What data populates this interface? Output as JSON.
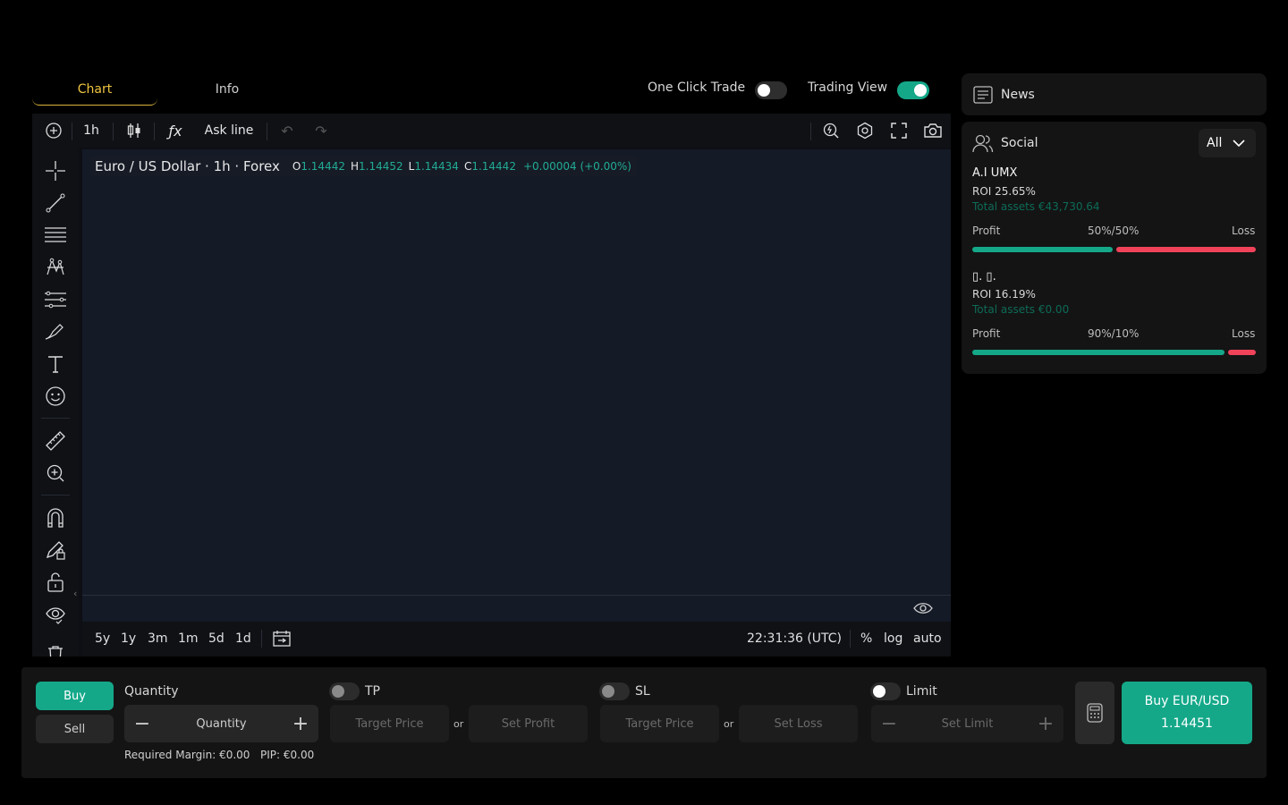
{
  "tabs": [
    {
      "label": "Chart",
      "active": true
    },
    {
      "label": "Info",
      "active": false
    }
  ],
  "toggles": {
    "one_click_trade": {
      "label": "One Click Trade",
      "on": false
    },
    "trading_view": {
      "label": "Trading View",
      "on": true
    }
  },
  "chart_toolbar": {
    "interval": "1h",
    "price_line": "Ask line"
  },
  "chart_legend": {
    "title": "Euro / US Dollar · 1h · Forex",
    "open_label": "O",
    "open": "1.14442",
    "high_label": "H",
    "high": "1.14452",
    "low_label": "L",
    "low": "1.14434",
    "close_label": "C",
    "close": "1.14442",
    "change": "+0.00004 (+0.00%)"
  },
  "chart_bottom": {
    "ranges": [
      "5y",
      "1y",
      "3m",
      "1m",
      "5d",
      "1d"
    ],
    "time": "22:31:36 (UTC)",
    "percent": "%",
    "log": "log",
    "auto": "auto"
  },
  "news": {
    "title": "News"
  },
  "social": {
    "title": "Social",
    "filter": "All",
    "traders": [
      {
        "name": "A.I UMX",
        "roi": "ROI 25.65%",
        "assets": "Total assets €43,730.64",
        "profit_label": "Profit",
        "split": "50%/50%",
        "loss_label": "Loss",
        "profit_share": 0.5
      },
      {
        "name": "▯. ▯.",
        "roi": "ROI 16.19%",
        "assets": "Total assets €0.00",
        "profit_label": "Profit",
        "split": "90%/10%",
        "loss_label": "Loss",
        "profit_share": 0.9
      }
    ]
  },
  "order": {
    "buy": "Buy",
    "sell": "Sell",
    "quantity_label": "Quantity",
    "quantity_placeholder": "Quantity",
    "required_margin": "Required Margin: €0.00",
    "pip": "PIP: €0.00",
    "tp_label": "TP",
    "sl_label": "SL",
    "limit_label": "Limit",
    "target_price": "Target Price",
    "set_profit": "Set Profit",
    "set_loss": "Set Loss",
    "set_limit": "Set Limit",
    "or": "or",
    "submit_line1": "Buy EUR/USD",
    "submit_line2": "1.14451"
  },
  "colors": {
    "accent": "#14a889",
    "loss": "#f0435a",
    "tab_active": "#f0c541"
  }
}
